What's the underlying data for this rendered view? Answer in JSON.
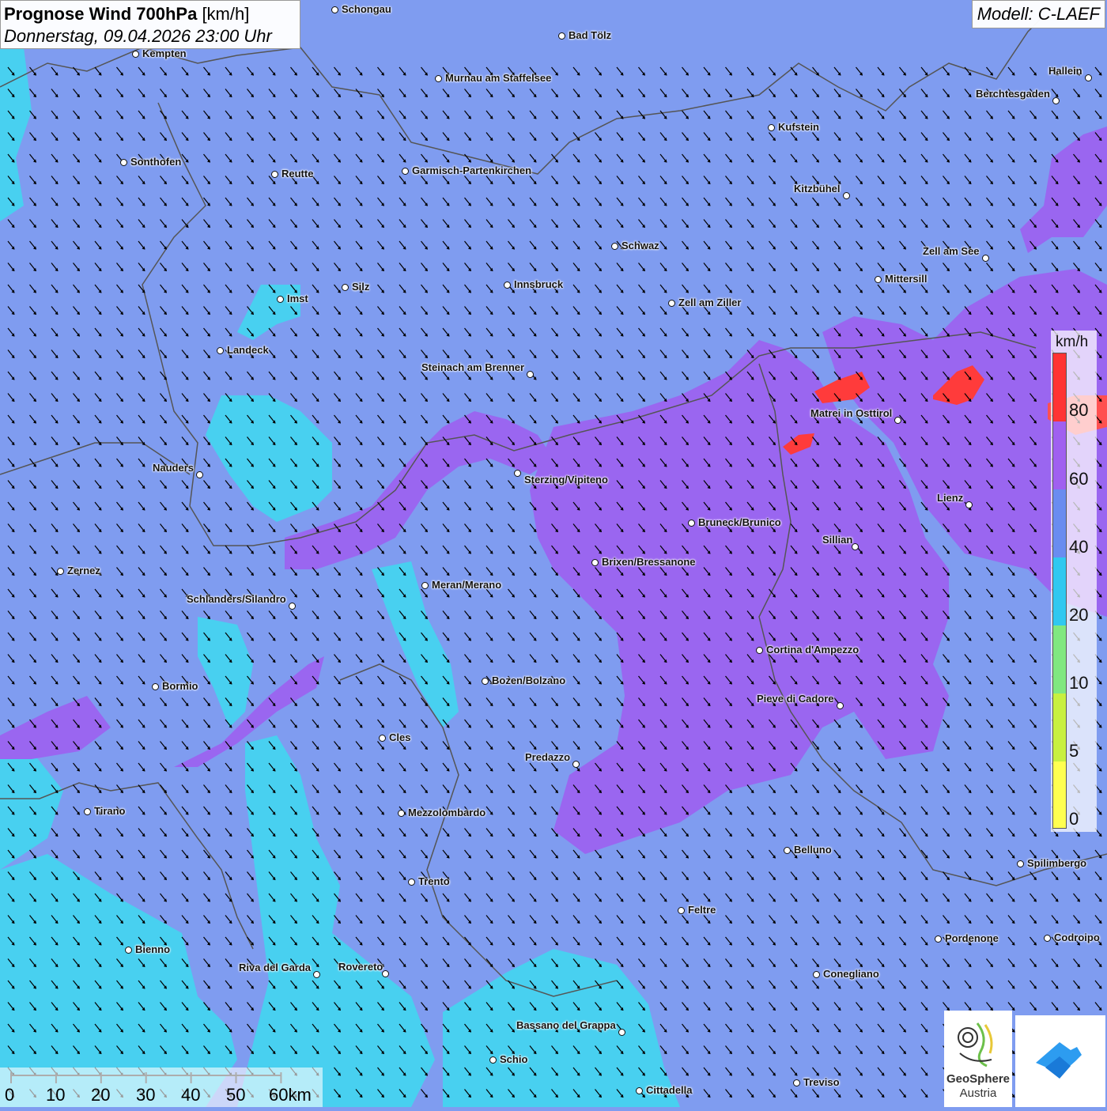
{
  "title": {
    "bold": "Prognose Wind 700hPa",
    "unit": "[km/h]",
    "datetime": "Donnerstag, 09.04.2026 23:00 Uhr"
  },
  "model": "Modell: C-LAEF",
  "legend": {
    "unit": "km/h",
    "ticks": [
      "80",
      "60",
      "40",
      "20",
      "10",
      "5",
      "0"
    ],
    "colors": [
      "#ff3333",
      "#a060f0",
      "#6a8cf0",
      "#30c8f0",
      "#80e880",
      "#c8f040",
      "#ffff50"
    ]
  },
  "scale": {
    "labels": [
      "0",
      "10",
      "20",
      "30",
      "40",
      "50",
      "60km"
    ]
  },
  "logos": {
    "geosphere_line1": "GeoSphere",
    "geosphere_line2": "Austria"
  },
  "colors": {
    "base": "#7f9cf0",
    "cyan": "#48d0f0",
    "purple": "#9a66f0",
    "red": "#ff3b3b",
    "border": "#555555"
  },
  "cities": [
    {
      "name": "Schongau"
    },
    {
      "name": "Bad Tölz"
    },
    {
      "name": "Kempten"
    },
    {
      "name": "Murnau am Staffelsee"
    },
    {
      "name": "Hallein"
    },
    {
      "name": "Berchtesgaden"
    },
    {
      "name": "Kufstein"
    },
    {
      "name": "Sonthofen"
    },
    {
      "name": "Reutte"
    },
    {
      "name": "Garmisch-Partenkirchen"
    },
    {
      "name": "Kitzbühel"
    },
    {
      "name": "Schwaz"
    },
    {
      "name": "Zell am See"
    },
    {
      "name": "Mittersill"
    },
    {
      "name": "Innsbruck"
    },
    {
      "name": "Silz"
    },
    {
      "name": "Imst"
    },
    {
      "name": "Zell am Ziller"
    },
    {
      "name": "Landeck"
    },
    {
      "name": "Steinach am Brenner"
    },
    {
      "name": "Matrei in Osttirol"
    },
    {
      "name": "Nauders"
    },
    {
      "name": "Sterzing/Vipiteno"
    },
    {
      "name": "Lienz"
    },
    {
      "name": "Bruneck/Brunico"
    },
    {
      "name": "Sillian"
    },
    {
      "name": "Brixen/Bressanone"
    },
    {
      "name": "Zernez"
    },
    {
      "name": "Meran/Merano"
    },
    {
      "name": "Schlanders/Silandro"
    },
    {
      "name": "Cortina d'Ampezzo"
    },
    {
      "name": "Bozen/Bolzano"
    },
    {
      "name": "Bormio"
    },
    {
      "name": "Pieve di Cadore"
    },
    {
      "name": "Cles"
    },
    {
      "name": "Predazzo"
    },
    {
      "name": "Tirano"
    },
    {
      "name": "Mezzolombardo"
    },
    {
      "name": "Belluno"
    },
    {
      "name": "Spilimbergo"
    },
    {
      "name": "Trento"
    },
    {
      "name": "Feltre"
    },
    {
      "name": "Bienno"
    },
    {
      "name": "Pordenone"
    },
    {
      "name": "Codroipo"
    },
    {
      "name": "Riva del Garda"
    },
    {
      "name": "Rovereto"
    },
    {
      "name": "Conegliano"
    },
    {
      "name": "Bassano del Grappa"
    },
    {
      "name": "Schio"
    },
    {
      "name": "Treviso"
    },
    {
      "name": "Cittadella"
    }
  ]
}
